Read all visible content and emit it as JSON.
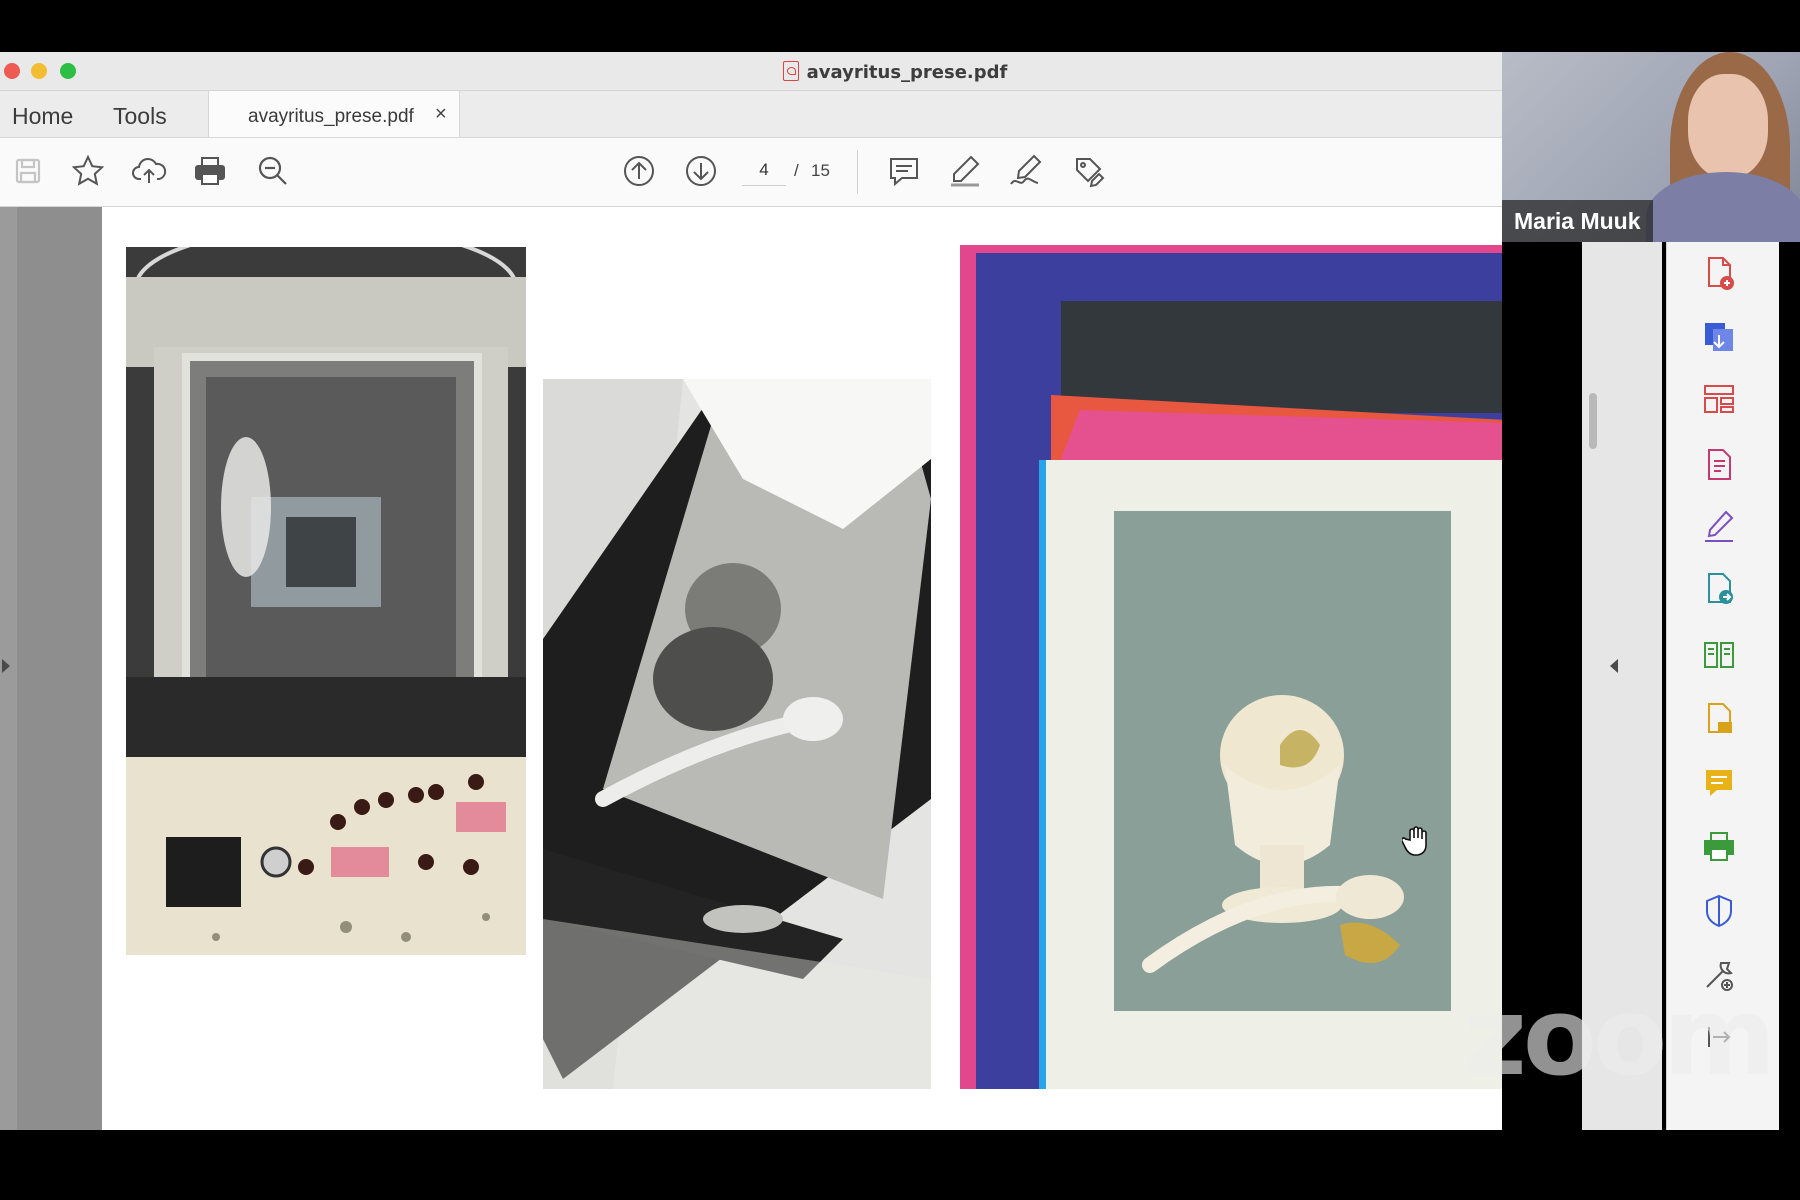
{
  "window": {
    "title": "avayritus_prese.pdf",
    "tabs": {
      "home": "Home",
      "tools": "Tools"
    },
    "document_tab": {
      "label": "avayritus_prese.pdf",
      "close_glyph": "×"
    }
  },
  "toolbar": {
    "left_icons": [
      "save-icon",
      "bookmark-star-icon",
      "upload-cloud-icon",
      "print-icon",
      "zoom-out-icon"
    ],
    "nav_icons": [
      "previous-page-icon",
      "next-page-icon"
    ],
    "page_current": "4",
    "page_separator": "/",
    "page_total": "15",
    "tool_icons": [
      "comment-icon",
      "highlight-icon",
      "sign-icon",
      "edit-tag-icon"
    ]
  },
  "document": {
    "current_page": 4,
    "images": [
      "photo-machine",
      "photo-contact-print",
      "photo-colour-print"
    ]
  },
  "right_panel": {
    "icons": [
      "search-icon",
      "create-pdf-icon",
      "export-pdf-icon",
      "organize-pages-icon",
      "edit-pdf-icon",
      "fill-sign-icon",
      "send-file-icon",
      "compare-icon",
      "protect-file-icon",
      "comment-tool-icon",
      "print-production-icon",
      "protect-icon",
      "more-tools-icon",
      "collapse-panel-icon"
    ]
  },
  "zoom": {
    "participant_name": "Maria Muuk",
    "watermark": "zoom"
  },
  "colors": {
    "window_bg": "#ffffff",
    "viewport_bg": "#8e8e8e",
    "acrobat_red": "#d94a4a",
    "acrobat_blue": "#3a5bd6",
    "acrobat_green": "#3b9a3b",
    "acrobat_yellow": "#d9a219"
  }
}
